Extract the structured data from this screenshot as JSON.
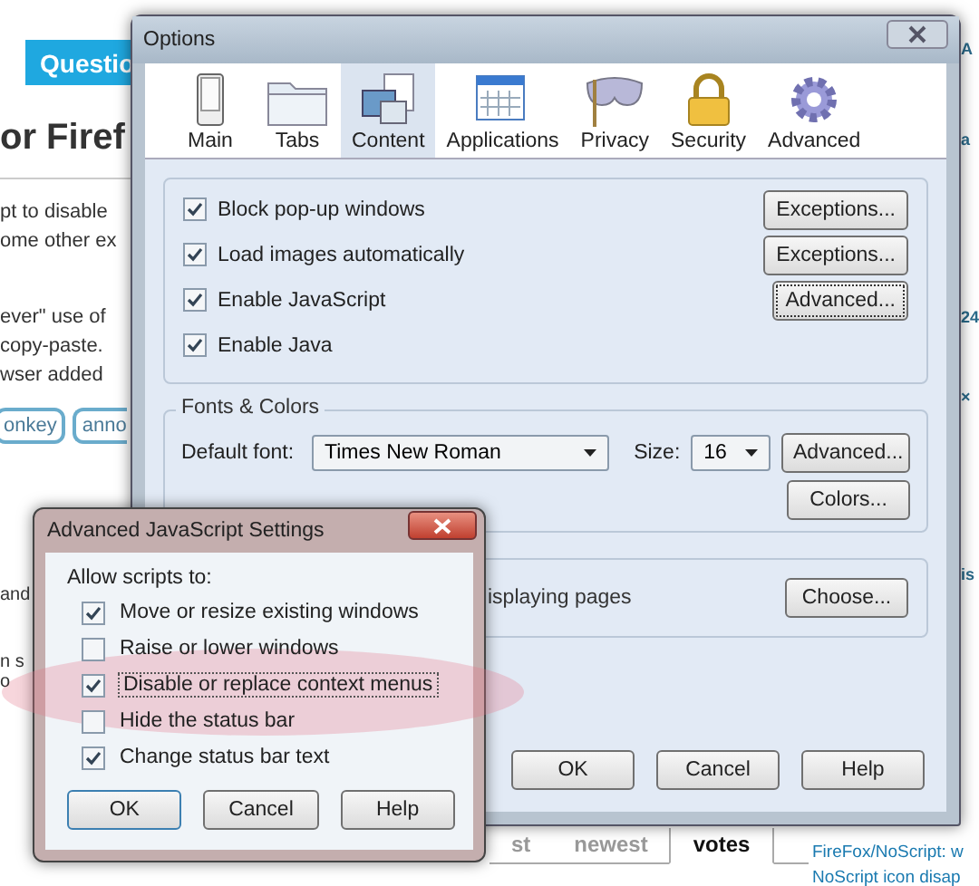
{
  "background_page": {
    "header_tab": "Questio",
    "title": "or Firef",
    "lines": [
      "pt to disable",
      "ome other ex",
      "ever\" use of",
      "copy-paste.",
      "wser added"
    ],
    "tags": [
      "onkey",
      "anno"
    ],
    "left_texts": [
      "and",
      "n s",
      "o"
    ],
    "right_texts": [
      "A",
      "a",
      "24",
      "×",
      "is"
    ],
    "sort_tabs": [
      {
        "label": "st",
        "selected": false
      },
      {
        "label": "newest",
        "selected": false
      },
      {
        "label": "votes",
        "selected": true
      }
    ],
    "related": [
      "FireFox/NoScript: w",
      "NoScript icon disap"
    ]
  },
  "options": {
    "title": "Options",
    "tabs": [
      {
        "label": "Main",
        "selected": false
      },
      {
        "label": "Tabs",
        "selected": false
      },
      {
        "label": "Content",
        "selected": true
      },
      {
        "label": "Applications",
        "selected": false
      },
      {
        "label": "Privacy",
        "selected": false
      },
      {
        "label": "Security",
        "selected": false
      },
      {
        "label": "Advanced",
        "selected": false
      }
    ],
    "content_rows": [
      {
        "label": "Block pop-up windows",
        "checked": true,
        "button": "Exceptions..."
      },
      {
        "label": "Load images automatically",
        "checked": true,
        "button": "Exceptions..."
      },
      {
        "label": "Enable JavaScript",
        "checked": true,
        "button": "Advanced..."
      },
      {
        "label": "Enable Java",
        "checked": true
      }
    ],
    "fonts": {
      "legend": "Fonts & Colors",
      "font_label": "Default font:",
      "font_value": "Times New Roman",
      "size_label": "Size:",
      "size_value": "16",
      "advanced_button": "Advanced...",
      "colors_button": "Colors..."
    },
    "languages": {
      "text": "isplaying pages",
      "button": "Choose..."
    },
    "buttons": [
      "OK",
      "Cancel",
      "Help"
    ]
  },
  "js_dialog": {
    "title": "Advanced JavaScript Settings",
    "heading": "Allow scripts to:",
    "options": [
      {
        "label": "Move or resize existing windows",
        "checked": true
      },
      {
        "label": "Raise or lower windows",
        "checked": false
      },
      {
        "label": "Disable or replace context menus",
        "checked": true
      },
      {
        "label": "Hide the status bar",
        "checked": false
      },
      {
        "label": "Change status bar text",
        "checked": true
      }
    ],
    "buttons": [
      "OK",
      "Cancel",
      "Help"
    ]
  }
}
